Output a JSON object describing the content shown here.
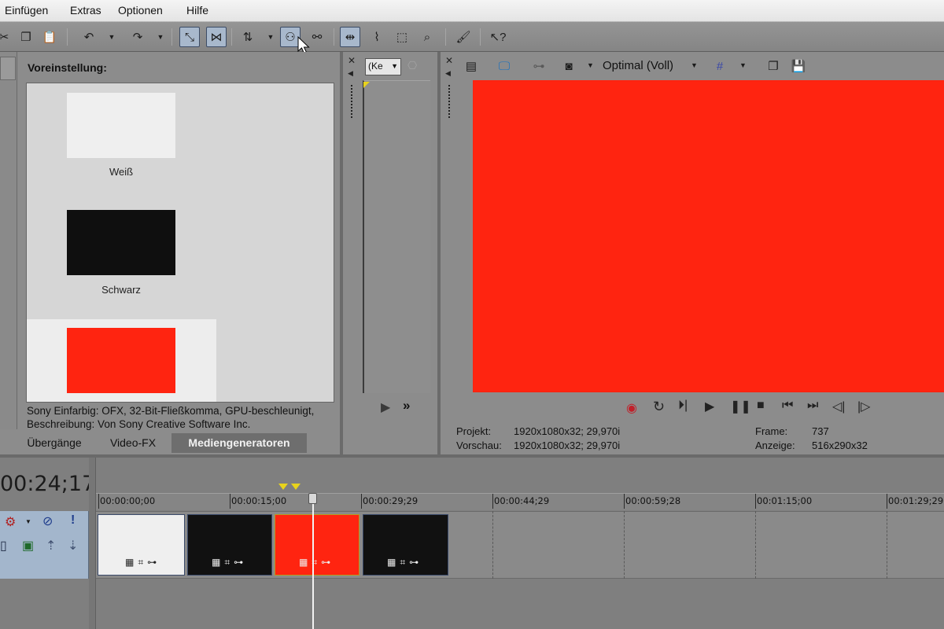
{
  "menu": [
    "Einfügen",
    "Extras",
    "Optionen",
    "Hilfe"
  ],
  "media_generators": {
    "preset_heading": "Voreinstellung:",
    "presets": [
      {
        "label": "Weiß",
        "color": "#efefef"
      },
      {
        "label": "Schwarz",
        "color": "#0f0f0f"
      },
      {
        "label": "",
        "color": "#ff2410",
        "selected": true
      }
    ],
    "description_line1": "Sony Einfarbig: OFX, 32-Bit-Fließkomma, GPU-beschleunigt,",
    "description_line2": "Beschreibung: Von Sony Creative Software Inc.",
    "tabs": [
      "Übergänge",
      "Video-FX",
      "Mediengeneratoren"
    ],
    "active_tab": "Mediengeneratoren"
  },
  "middle_panel": {
    "dropdown_value": "(Ke",
    "arrows": "▶ »"
  },
  "preview": {
    "quality": "Optimal (Voll)",
    "color": "#ff2410",
    "project_label": "Projekt:",
    "project_value": "1920x1080x32; 29,970i",
    "preview_label": "Vorschau:",
    "preview_value": "1920x1080x32; 29,970i",
    "frame_label": "Frame:",
    "frame_value": "737",
    "display_label": "Anzeige:",
    "display_value": "516x290x32"
  },
  "timeline": {
    "timecode": "00:24;17",
    "ruler": [
      "00:00:00;00",
      "00:00:15;00",
      "00:00:29;29",
      "00:00:44;29",
      "00:00:59;28",
      "00:01:15;00",
      "00:01:29;29"
    ],
    "clips": [
      {
        "color": "#efefef"
      },
      {
        "color": "#111111"
      },
      {
        "color": "#ff2410"
      },
      {
        "color": "#111111"
      }
    ]
  }
}
